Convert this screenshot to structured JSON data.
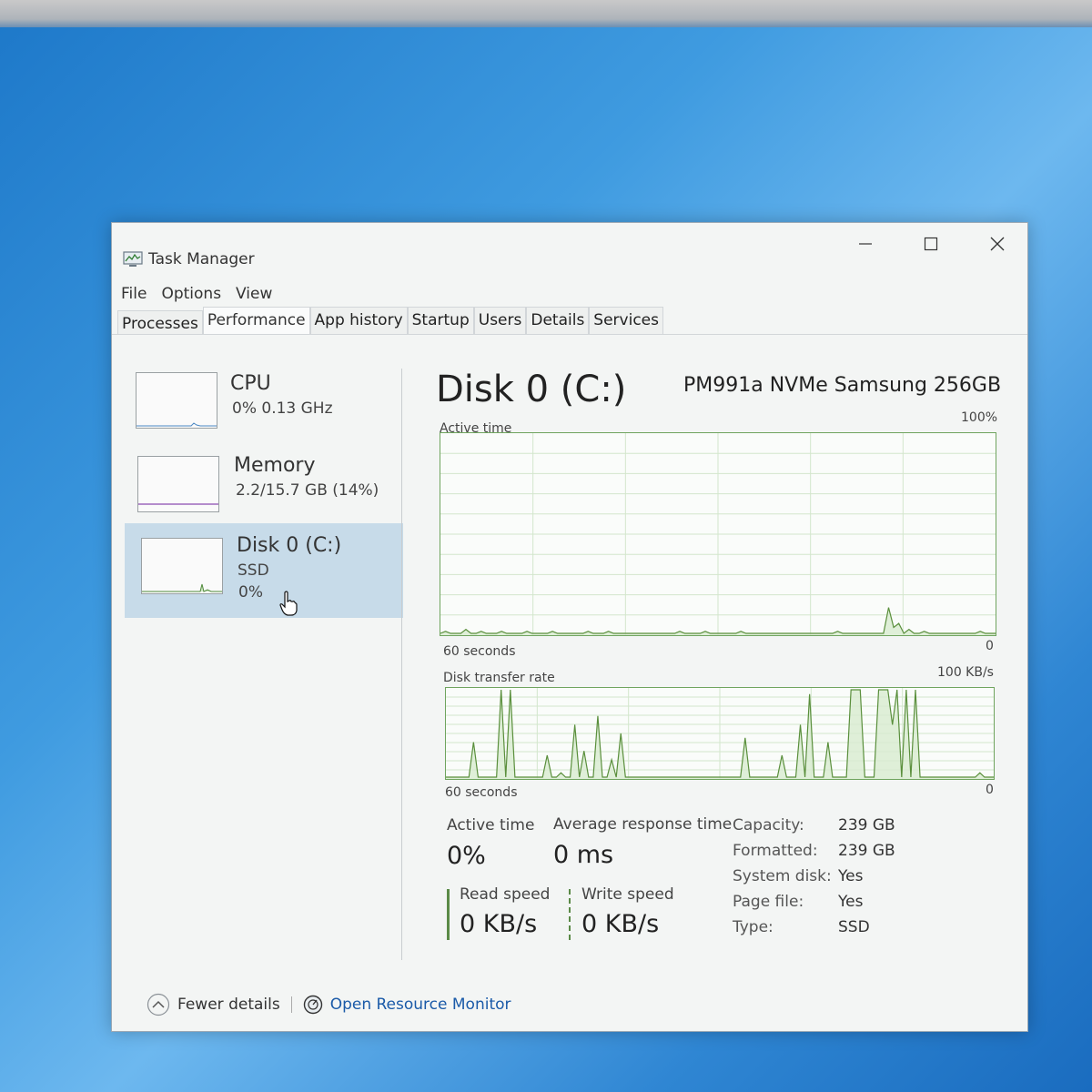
{
  "window": {
    "title": "Task Manager"
  },
  "menu": [
    "File",
    "Options",
    "View"
  ],
  "tabs": [
    {
      "label": "Processes",
      "active": false
    },
    {
      "label": "Performance",
      "active": true
    },
    {
      "label": "App history",
      "active": false
    },
    {
      "label": "Startup",
      "active": false
    },
    {
      "label": "Users",
      "active": false
    },
    {
      "label": "Details",
      "active": false
    },
    {
      "label": "Services",
      "active": false
    }
  ],
  "sidebar": {
    "items": [
      {
        "title": "CPU",
        "sub1": "0%  0.13 GHz",
        "sub2": ""
      },
      {
        "title": "Memory",
        "sub1": "2.2/15.7 GB (14%)",
        "sub2": ""
      },
      {
        "title": "Disk 0 (C:)",
        "sub1": "SSD",
        "sub2": "0%",
        "selected": true
      }
    ]
  },
  "main": {
    "title": "Disk 0 (C:)",
    "model": "PM991a NVMe Samsung 256GB",
    "graph1": {
      "label": "Active time",
      "max": "100%",
      "duration": "60 seconds",
      "min": "0"
    },
    "graph2": {
      "label": "Disk transfer rate",
      "max": "100 KB/s",
      "duration": "60 seconds",
      "min": "0"
    },
    "stats": {
      "active_time_label": "Active time",
      "active_time_value": "0%",
      "avg_response_label": "Average response time",
      "avg_response_value": "0 ms",
      "read_label": "Read speed",
      "read_value": "0 KB/s",
      "write_label": "Write speed",
      "write_value": "0 KB/s"
    },
    "properties": [
      {
        "key": "Capacity:",
        "value": "239 GB"
      },
      {
        "key": "Formatted:",
        "value": "239 GB"
      },
      {
        "key": "System disk:",
        "value": "Yes"
      },
      {
        "key": "Page file:",
        "value": "Yes"
      },
      {
        "key": "Type:",
        "value": "SSD"
      }
    ]
  },
  "footer": {
    "fewer_details": "Fewer details",
    "resource_monitor": "Open Resource Monitor"
  },
  "graph_data": {
    "active_time_percent": [
      0,
      1,
      0,
      0,
      0,
      2,
      0,
      0,
      1,
      0,
      0,
      0,
      1,
      0,
      0,
      0,
      0,
      1,
      0,
      0,
      0,
      0,
      1,
      0,
      0,
      0,
      0,
      0,
      0,
      1,
      0,
      0,
      0,
      1,
      0,
      0,
      0,
      0,
      0,
      0,
      0,
      0,
      0,
      0,
      0,
      0,
      0,
      1,
      0,
      0,
      0,
      0,
      1,
      0,
      0,
      0,
      0,
      0,
      0,
      1,
      0,
      0,
      0,
      0,
      0,
      0,
      0,
      0,
      0,
      0,
      0,
      0,
      0,
      0,
      0,
      0,
      0,
      0,
      1,
      0,
      0,
      0,
      0,
      0,
      0,
      0,
      0,
      0,
      13,
      3,
      5,
      0,
      2,
      0,
      0,
      1,
      0,
      0,
      0,
      0,
      0,
      0,
      0,
      0,
      0,
      0,
      1,
      0,
      0,
      0
    ],
    "transfer_rate_kbs": [
      0,
      0,
      0,
      0,
      0,
      0,
      40,
      0,
      0,
      0,
      0,
      0,
      100,
      0,
      100,
      0,
      0,
      0,
      0,
      0,
      0,
      0,
      25,
      0,
      0,
      5,
      0,
      0,
      60,
      0,
      30,
      0,
      0,
      70,
      0,
      0,
      20,
      0,
      50,
      0,
      0,
      0,
      0,
      0,
      0,
      0,
      0,
      0,
      0,
      0,
      0,
      0,
      0,
      0,
      0,
      0,
      0,
      0,
      0,
      0,
      0,
      0,
      0,
      0,
      0,
      45,
      0,
      0,
      0,
      0,
      0,
      0,
      0,
      25,
      0,
      0,
      0,
      60,
      0,
      95,
      0,
      0,
      0,
      40,
      0,
      0,
      0,
      0,
      100,
      100,
      100,
      0,
      0,
      0,
      100,
      100,
      100,
      60,
      100,
      0,
      100,
      0,
      100,
      0,
      0,
      0,
      0,
      0,
      0,
      0,
      0,
      0,
      0,
      0,
      0,
      0,
      5,
      0,
      0,
      0
    ]
  }
}
